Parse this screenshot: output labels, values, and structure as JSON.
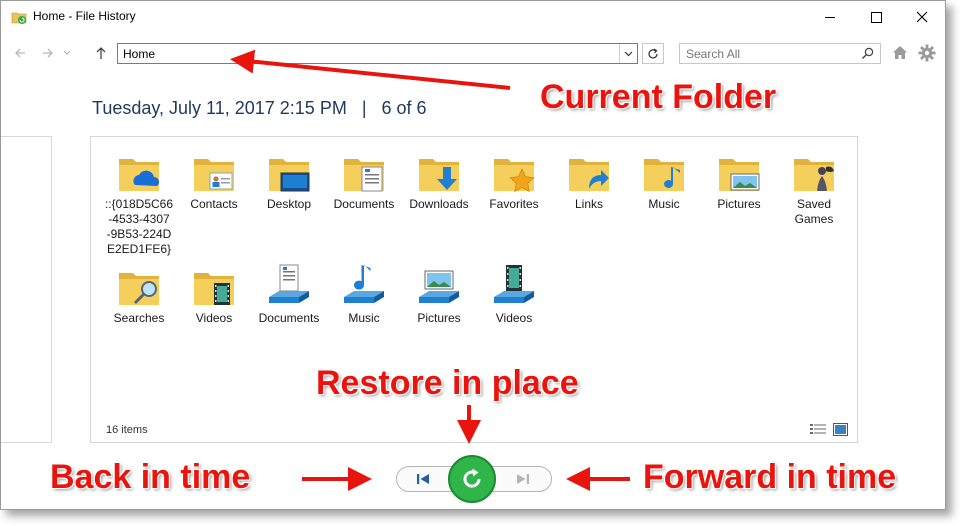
{
  "window": {
    "title": "Home - File History",
    "minimize_label": "Minimize",
    "maximize_label": "Maximize",
    "close_label": "Close"
  },
  "nav": {
    "back_icon": "back-arrow-icon",
    "forward_icon": "forward-arrow-icon",
    "up_icon": "up-arrow-icon",
    "address": "Home",
    "search_placeholder": "Search All"
  },
  "header": {
    "date": "Tuesday, July 11, 2017 2:15 PM",
    "separator": "|",
    "position": "6 of 6"
  },
  "items": [
    {
      "label": "::{018D5C66\n-4533-4307\n-9B53-224D\nE2ED1FE6}",
      "icon": "onedrive-folder-icon"
    },
    {
      "label": "Contacts",
      "icon": "contacts-folder-icon"
    },
    {
      "label": "Desktop",
      "icon": "desktop-folder-icon"
    },
    {
      "label": "Documents",
      "icon": "documents-folder-icon"
    },
    {
      "label": "Downloads",
      "icon": "downloads-folder-icon"
    },
    {
      "label": "Favorites",
      "icon": "favorites-folder-icon"
    },
    {
      "label": "Links",
      "icon": "links-folder-icon"
    },
    {
      "label": "Music",
      "icon": "music-folder-icon"
    },
    {
      "label": "Pictures",
      "icon": "pictures-folder-icon"
    },
    {
      "label": "Saved\nGames",
      "icon": "saved-games-folder-icon"
    },
    {
      "label": "Searches",
      "icon": "searches-folder-icon"
    },
    {
      "label": "Videos",
      "icon": "videos-folder-icon"
    },
    {
      "label": "Documents",
      "icon": "documents-library-icon"
    },
    {
      "label": "Music",
      "icon": "music-library-icon"
    },
    {
      "label": "Pictures",
      "icon": "pictures-library-icon"
    },
    {
      "label": "Videos",
      "icon": "videos-library-icon"
    }
  ],
  "status": {
    "item_count": "16 items"
  },
  "annotations": {
    "current_folder": "Current Folder",
    "restore_in_place": "Restore in place",
    "back_in_time": "Back in time",
    "forward_in_time": "Forward in time"
  },
  "colors": {
    "annotation_red": "#e8140d",
    "restore_green": "#2fb54a",
    "folder_yellow": "#f2c94c",
    "accent_blue": "#1f7fd1"
  }
}
